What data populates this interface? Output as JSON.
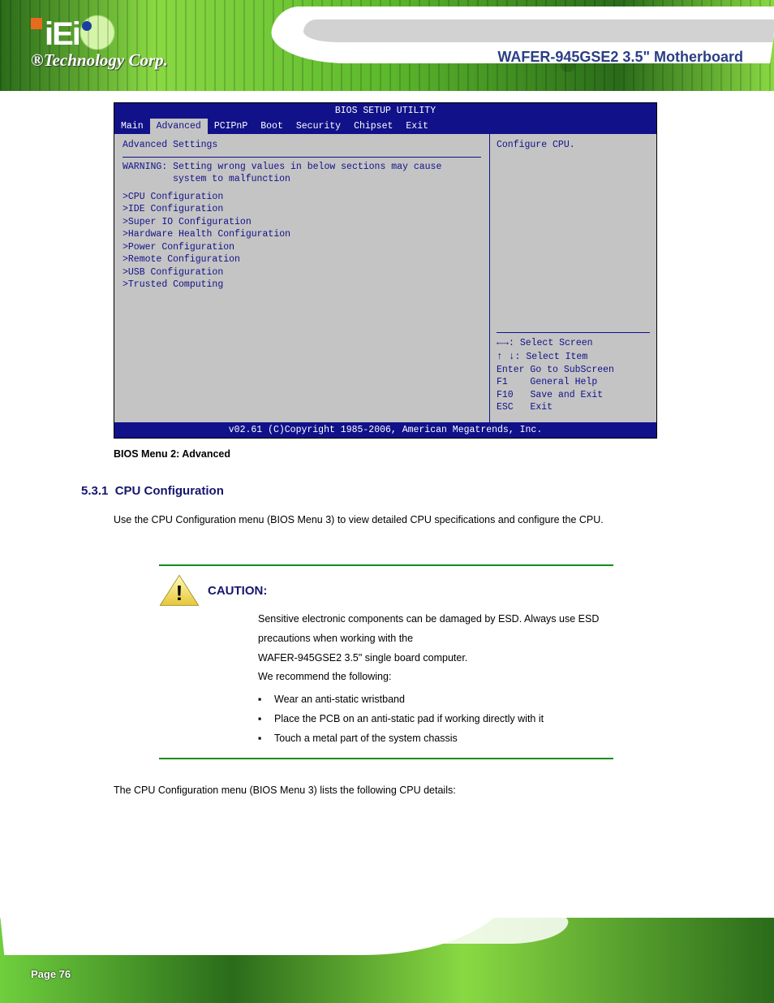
{
  "header": {
    "logo_text": "iEi",
    "tagline": "®Technology Corp.",
    "model": "WAFER-945GSE2 3.5\" Motherboard"
  },
  "bios": {
    "title": "BIOS SETUP UTILITY",
    "tabs": [
      "Main",
      "Advanced",
      "PCIPnP",
      "Boot",
      "Security",
      "Chipset",
      "Exit"
    ],
    "active_tab": 1,
    "left": {
      "heading": "Advanced Settings",
      "warning_line1": "WARNING: Setting wrong values in below sections may cause",
      "warning_line2": "system to malfunction",
      "menu": [
        "CPU Configuration",
        "IDE Configuration",
        "Super IO Configuration",
        "Hardware Health Configuration",
        "Power Configuration",
        "Remote Configuration",
        "USB Configuration",
        "Trusted Computing"
      ]
    },
    "right": {
      "help": "Configure CPU.",
      "nav": {
        "select_screen": ": Select Screen",
        "select_item": ": Select Item",
        "enter_label": "Enter",
        "enter_desc": "Go to SubScreen",
        "f1_label": "F1",
        "f1_desc": "General Help",
        "f10_label": "F10",
        "f10_desc": "Save and Exit",
        "esc_label": "ESC",
        "esc_desc": "Exit"
      }
    },
    "footer": "v02.61 (C)Copyright 1985-2006, American Megatrends, Inc.",
    "caption": "BIOS Menu 2: Advanced"
  },
  "section": {
    "number": "5.3.1",
    "title": "CPU Configuration",
    "para1": "Use the CPU Configuration menu (BIOS Menu 3) to view detailed CPU specifications and configure the CPU.",
    "para2": "The CPU Configuration menu (BIOS Menu 3) lists the following CPU details:"
  },
  "caution": {
    "title": "CAUTION:",
    "lead": "Sensitive electronic components can be damaged by ESD. Always use ESD precautions when working with the",
    "product_line": "WAFER-945GSE2 3.5\" single board computer.",
    "recommend_lead": "We recommend the following:",
    "items": [
      "Wear an anti-static wristband",
      "Place the PCB on an anti-static pad if working directly with it",
      "Touch a metal part of the system chassis"
    ]
  },
  "footer": {
    "page": "Page 76"
  }
}
